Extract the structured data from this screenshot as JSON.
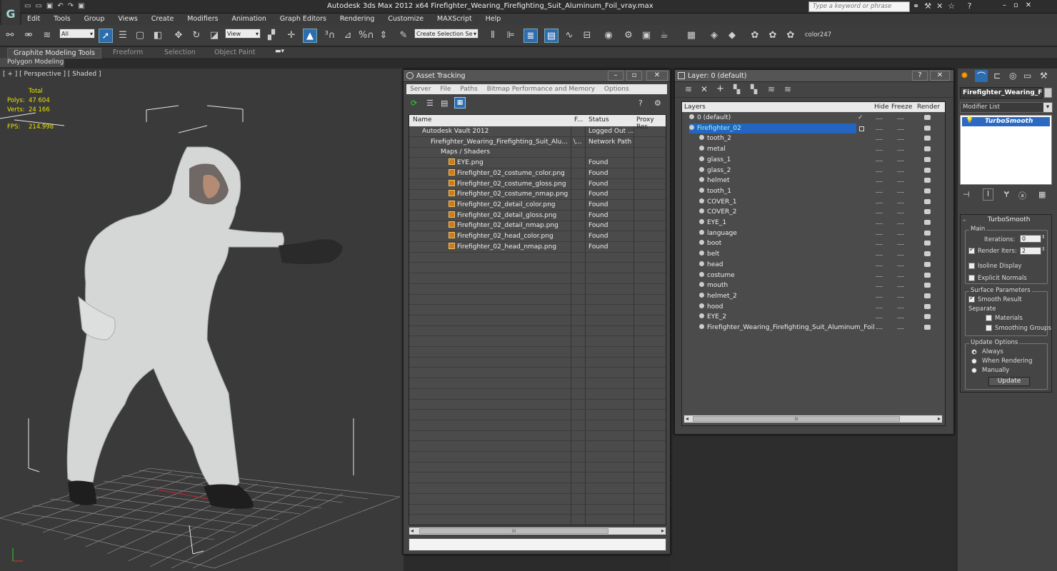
{
  "app": {
    "title": "Autodesk 3ds Max  2012 x64     Firefighter_Wearing_Firefighting_Suit_Aluminum_Foil_vray.max",
    "search_placeholder": "Type a keyword or phrase"
  },
  "menu": [
    "Edit",
    "Tools",
    "Group",
    "Views",
    "Create",
    "Modifiers",
    "Animation",
    "Graph Editors",
    "Rendering",
    "Customize",
    "MAXScript",
    "Help"
  ],
  "toolbar": {
    "selection_filter": "All",
    "coord_system": "View",
    "named_selection": "Create Selection Se",
    "color_label": "color247"
  },
  "ribbon": {
    "tabs": [
      "Graphite Modeling Tools",
      "Freeform",
      "Selection",
      "Object Paint"
    ],
    "sub_tab": "Polygon Modeling"
  },
  "viewport": {
    "label": "[ + ] [ Perspective ] [ Shaded ]",
    "stats": {
      "total_label": "Total",
      "polys_label": "Polys:",
      "polys_value": "47 604",
      "verts_label": "Verts:",
      "verts_value": "24 166",
      "fps_label": "FPS:",
      "fps_value": "214.998"
    }
  },
  "asset_tracking": {
    "title": "Asset Tracking",
    "menu": [
      "Server",
      "File",
      "Paths",
      "Bitmap Performance and Memory",
      "Options"
    ],
    "columns": [
      "Name",
      "F...",
      "Status",
      "Proxy Res"
    ],
    "rows": [
      {
        "name": "Autodesk Vault 2012",
        "f": "",
        "status": "Logged Out ..."
      },
      {
        "name": "Firefighter_Wearing_Firefighting_Suit_Alu...",
        "f": "\\...",
        "status": "Network Path"
      },
      {
        "name": "Maps / Shaders",
        "f": "",
        "status": ""
      },
      {
        "name": "EYE.png",
        "f": "",
        "status": "Found"
      },
      {
        "name": "Firefighter_02_costume_color.png",
        "f": "",
        "status": "Found"
      },
      {
        "name": "Firefighter_02_costume_gloss.png",
        "f": "",
        "status": "Found"
      },
      {
        "name": "Firefighter_02_costume_nmap.png",
        "f": "",
        "status": "Found"
      },
      {
        "name": "Firefighter_02_detail_color.png",
        "f": "",
        "status": "Found"
      },
      {
        "name": "Firefighter_02_detail_gloss.png",
        "f": "",
        "status": "Found"
      },
      {
        "name": "Firefighter_02_detail_nmap.png",
        "f": "",
        "status": "Found"
      },
      {
        "name": "Firefighter_02_head_color.png",
        "f": "",
        "status": "Found"
      },
      {
        "name": "Firefighter_02_head_nmap.png",
        "f": "",
        "status": "Found"
      }
    ],
    "scroll_label": "III"
  },
  "layer_manager": {
    "title": "Layer: 0 (default)",
    "columns": [
      "Layers",
      "Hide",
      "Freeze",
      "Render"
    ],
    "rows": [
      {
        "name": "0 (default)",
        "level": 0
      },
      {
        "name": "Firefighter_02",
        "level": 0
      },
      {
        "name": "tooth_2",
        "level": 1
      },
      {
        "name": "metal",
        "level": 1
      },
      {
        "name": "glass_1",
        "level": 1
      },
      {
        "name": "glass_2",
        "level": 1
      },
      {
        "name": "helmet",
        "level": 1
      },
      {
        "name": "tooth_1",
        "level": 1
      },
      {
        "name": "COVER_1",
        "level": 1
      },
      {
        "name": "COVER_2",
        "level": 1
      },
      {
        "name": "EYE_1",
        "level": 1
      },
      {
        "name": "language",
        "level": 1
      },
      {
        "name": "boot",
        "level": 1
      },
      {
        "name": "belt",
        "level": 1
      },
      {
        "name": "head",
        "level": 1
      },
      {
        "name": "costume",
        "level": 1
      },
      {
        "name": "mouth",
        "level": 1
      },
      {
        "name": "helmet_2",
        "level": 1
      },
      {
        "name": "hood",
        "level": 1
      },
      {
        "name": "EYE_2",
        "level": 1
      },
      {
        "name": "Firefighter_Wearing_Firefighting_Suit_Aluminum_Foil",
        "level": 1
      }
    ],
    "scroll_label": "III"
  },
  "command_panel": {
    "object_name": "Firefighter_Wearing_Fire",
    "modifier_list": "Modifier List",
    "modifier": "TurboSmooth",
    "rollout_title": "TurboSmooth",
    "main_group": "Main",
    "iterations_label": "Iterations:",
    "iterations_value": "0",
    "render_iters_label": "Render Iters:",
    "render_iters_value": "2",
    "isoline_label": "Isoline Display",
    "explicit_normals_label": "Explicit Normals",
    "surface_group": "Surface Parameters",
    "smooth_result_label": "Smooth Result",
    "separate_label": "Separate",
    "materials_label": "Materials",
    "smoothing_groups_label": "Smoothing Groups",
    "update_group": "Update Options",
    "always_label": "Always",
    "when_rendering_label": "When Rendering",
    "manually_label": "Manually",
    "update_button": "Update"
  },
  "colors": {
    "selection_blue": "#2465c2",
    "viewport_bg": "#3a3a3a",
    "stats_yellow": "#e8e400"
  }
}
